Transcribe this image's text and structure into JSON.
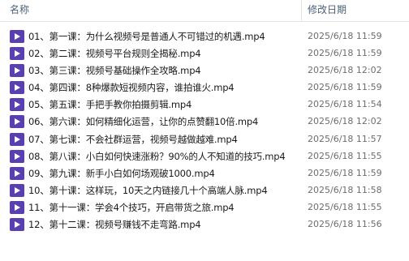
{
  "header": {
    "name_label": "名称",
    "date_label": "修改日期"
  },
  "colors": {
    "icon_bg": "#5a3fb0",
    "header_text": "#4c607a",
    "date_text": "#6d6d6d"
  },
  "files": [
    {
      "name": "01、第一课：为什么视频号是普通人不可错过的机遇.mp4",
      "date": "2025/6/18 11:59",
      "icon": "video-file-icon"
    },
    {
      "name": "02、第二课：视频号平台规则全揭秘.mp4",
      "date": "2025/6/18 11:59",
      "icon": "video-file-icon"
    },
    {
      "name": "03、第三课：视频号基础操作全攻略.mp4",
      "date": "2025/6/18 12:02",
      "icon": "video-file-icon"
    },
    {
      "name": "04、第四课：8种爆款短视频内容，谁拍谁火.mp4",
      "date": "2025/6/18 11:59",
      "icon": "video-file-icon"
    },
    {
      "name": "05、第五课：手把手教你拍摄剪辑.mp4",
      "date": "2025/6/18 11:54",
      "icon": "video-file-icon"
    },
    {
      "name": "06、第六课：如何精细化运营，让你的点赞翻10倍.mp4",
      "date": "2025/6/18 12:02",
      "icon": "video-file-icon"
    },
    {
      "name": "07、第七课：不会社群运营，视频号越做越难.mp4",
      "date": "2025/6/18 11:57",
      "icon": "video-file-icon"
    },
    {
      "name": "08、第八课：小白如何快速涨粉？90%的人不知道的技巧.mp4",
      "date": "2025/6/18 11:55",
      "icon": "video-file-icon"
    },
    {
      "name": "09、第九课：新手小白如何场观破1000.mp4",
      "date": "2025/6/18 11:59",
      "icon": "video-file-icon"
    },
    {
      "name": "10、第十课：这样玩，10天之内链接几十个高端人脉.mp4",
      "date": "2025/6/18 11:58",
      "icon": "video-file-icon"
    },
    {
      "name": "11、第十一课：学会4个技巧，开启带货之旅.mp4",
      "date": "2025/6/18 11:55",
      "icon": "video-file-icon"
    },
    {
      "name": "12、第十二课：视频号赚钱不走弯路.mp4",
      "date": "2025/6/18 11:56",
      "icon": "video-file-icon"
    }
  ]
}
